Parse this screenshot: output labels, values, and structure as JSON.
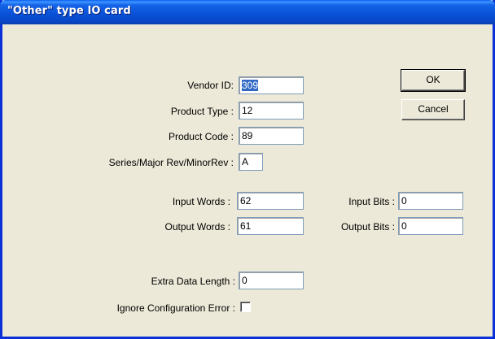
{
  "window": {
    "title": "\"Other\" type IO card"
  },
  "buttons": {
    "ok": "OK",
    "cancel": "Cancel"
  },
  "fields": {
    "vendor_id": {
      "label": "Vendor ID:",
      "value": "309"
    },
    "product_type": {
      "label": "Product Type :",
      "value": "12"
    },
    "product_code": {
      "label": "Product Code :",
      "value": "89"
    },
    "series_rev": {
      "label": "Series/Major Rev/MinorRev :",
      "value": "A"
    },
    "input_words": {
      "label": "Input Words :",
      "value": "62"
    },
    "output_words": {
      "label": "Output Words :",
      "value": "61"
    },
    "input_bits": {
      "label": "Input Bits :",
      "value": "0"
    },
    "output_bits": {
      "label": "Output Bits :",
      "value": "0"
    },
    "extra_data_length": {
      "label": "Extra Data Length :",
      "value": "0"
    },
    "ignore_config_error": {
      "label": "Ignore Configuration Error :",
      "checked": false
    }
  },
  "colors": {
    "dialog_bg": "#ece9d8",
    "titlebar": "#0a53d8",
    "selection": "#316ac5"
  }
}
